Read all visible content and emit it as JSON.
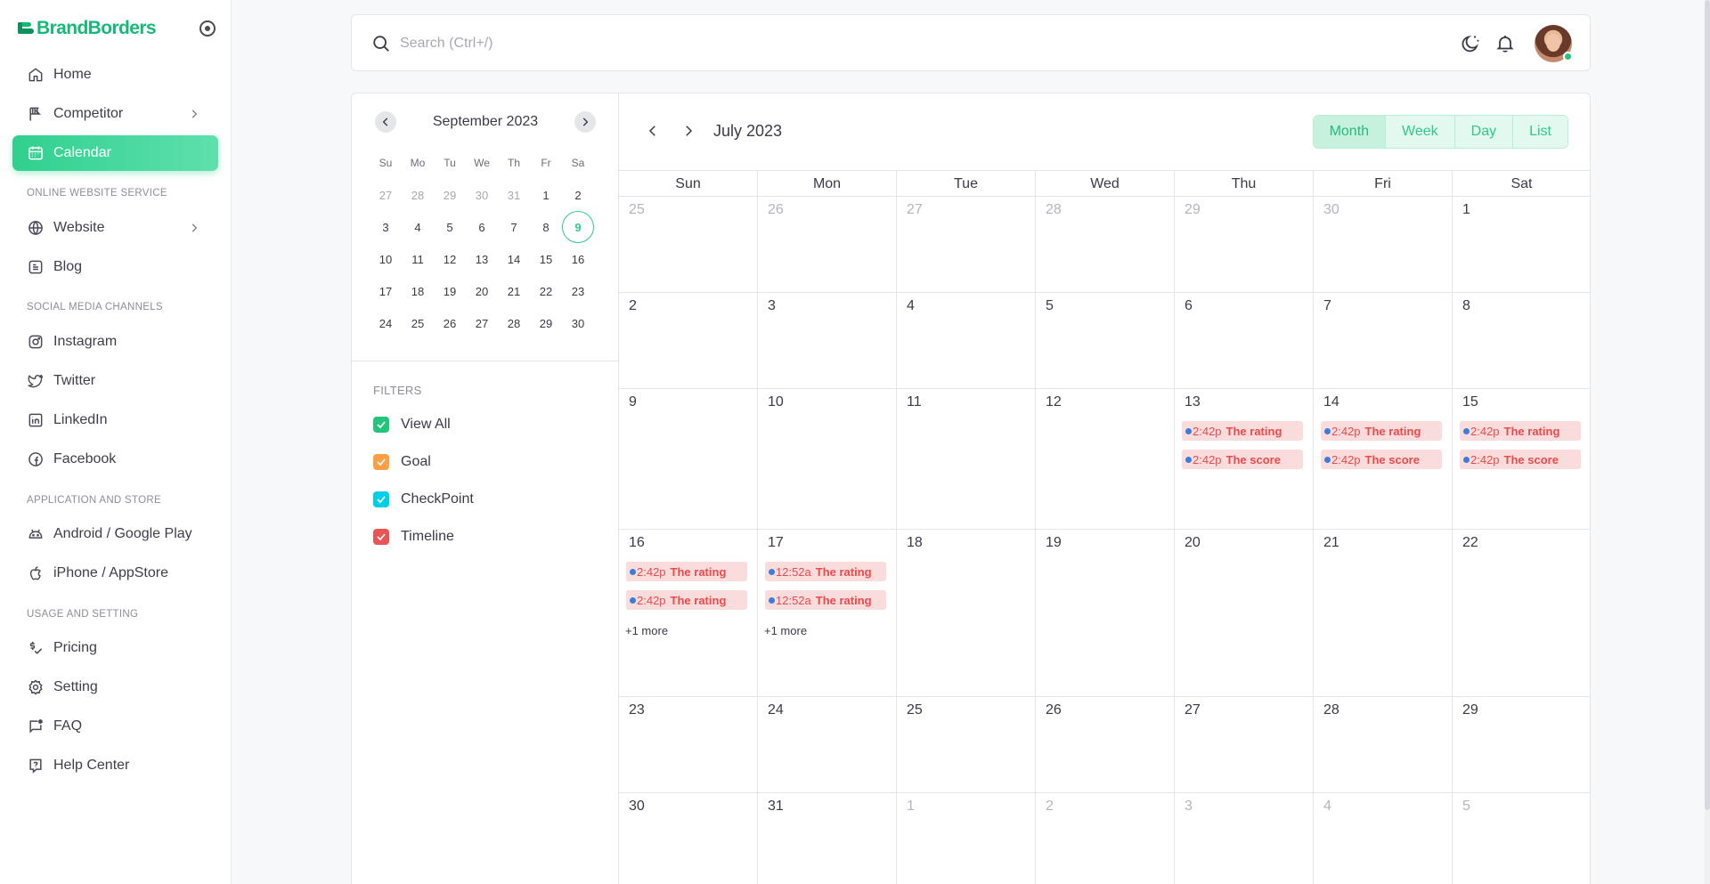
{
  "app": {
    "brand": "BrandBorders"
  },
  "sidebar": {
    "items": [
      {
        "label": "Home",
        "icon": "home-icon"
      },
      {
        "label": "Competitor",
        "icon": "flag-icon"
      },
      {
        "label": "Calendar",
        "icon": "calendar-icon"
      },
      {
        "label": "Website",
        "icon": "globe-icon"
      },
      {
        "label": "Blog",
        "icon": "blog-icon"
      },
      {
        "label": "Instagram",
        "icon": "instagram-icon"
      },
      {
        "label": "Twitter",
        "icon": "twitter-icon"
      },
      {
        "label": "LinkedIn",
        "icon": "linkedin-icon"
      },
      {
        "label": "Facebook",
        "icon": "facebook-icon"
      },
      {
        "label": "Android / Google Play",
        "icon": "android-icon"
      },
      {
        "label": "iPhone / AppStore",
        "icon": "apple-icon"
      },
      {
        "label": "Pricing",
        "icon": "pricing-icon"
      },
      {
        "label": "Setting",
        "icon": "gear-icon"
      },
      {
        "label": "FAQ",
        "icon": "faq-icon"
      },
      {
        "label": "Help Center",
        "icon": "help-icon"
      }
    ],
    "sections": [
      "ONLINE WEBSITE SERVICE",
      "SOCIAL MEDIA CHANNELS",
      "APPLICATION AND STORE",
      "USAGE AND SETTING"
    ]
  },
  "search": {
    "placeholder": "Search (Ctrl+/)"
  },
  "mini_calendar": {
    "title": "September 2023",
    "weekdays": [
      "Su",
      "Mo",
      "Tu",
      "We",
      "Th",
      "Fr",
      "Sa"
    ],
    "days": [
      "27",
      "28",
      "29",
      "30",
      "31",
      "1",
      "2",
      "3",
      "4",
      "5",
      "6",
      "7",
      "8",
      "9",
      "10",
      "11",
      "12",
      "13",
      "14",
      "15",
      "16",
      "17",
      "18",
      "19",
      "20",
      "21",
      "22",
      "23",
      "24",
      "25",
      "26",
      "27",
      "28",
      "29",
      "30"
    ],
    "selected": "9"
  },
  "filters": {
    "title": "FILTERS",
    "items": [
      {
        "label": "View All",
        "color": "#22c57a"
      },
      {
        "label": "Goal",
        "color": "#ff9f43"
      },
      {
        "label": "CheckPoint",
        "color": "#00cfe8"
      },
      {
        "label": "Timeline",
        "color": "#ea5455"
      }
    ]
  },
  "calendar": {
    "title": "July 2023",
    "views": [
      "Month",
      "Week",
      "Day",
      "List"
    ],
    "active_view": "Month",
    "weekdays": [
      "Sun",
      "Mon",
      "Tue",
      "Wed",
      "Thu",
      "Fri",
      "Sat"
    ],
    "days": [
      "25",
      "26",
      "27",
      "28",
      "29",
      "30",
      "1",
      "2",
      "3",
      "4",
      "5",
      "6",
      "7",
      "8",
      "9",
      "10",
      "11",
      "12",
      "13",
      "14",
      "15",
      "16",
      "17",
      "18",
      "19",
      "20",
      "21",
      "22",
      "23",
      "24",
      "25",
      "26",
      "27",
      "28",
      "29",
      "30",
      "31",
      "1",
      "2",
      "3",
      "4",
      "5"
    ],
    "events": {
      "13": [
        {
          "time": "2:42p",
          "title": "The rating"
        },
        {
          "time": "2:42p",
          "title": "The score"
        }
      ],
      "14": [
        {
          "time": "2:42p",
          "title": "The rating"
        },
        {
          "time": "2:42p",
          "title": "The score"
        }
      ],
      "15": [
        {
          "time": "2:42p",
          "title": "The rating"
        },
        {
          "time": "2:42p",
          "title": "The score"
        }
      ],
      "16": [
        {
          "time": "2:42p",
          "title": "The rating"
        },
        {
          "time": "2:42p",
          "title": "The rating"
        }
      ],
      "17": [
        {
          "time": "12:52a",
          "title": "The rating"
        },
        {
          "time": "12:52a",
          "title": "The rating"
        }
      ]
    },
    "more": {
      "16": "+1 more",
      "17": "+1 more"
    }
  }
}
